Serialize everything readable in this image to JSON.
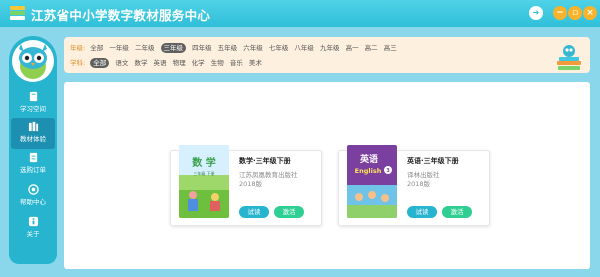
{
  "window": {
    "title": "江苏省中小学数字教材服务中心"
  },
  "colors": {
    "accent": "#26b4cf",
    "header": "#3fc8e0",
    "filter_bg": "#fdf0df",
    "activate": "#2fcf93",
    "title_buttons": "#f6b32b"
  },
  "sidebar": {
    "items": [
      {
        "label": "学习空间",
        "icon": "book-icon",
        "active": false
      },
      {
        "label": "教材体验",
        "icon": "books-icon",
        "active": true
      },
      {
        "label": "选购订单",
        "icon": "order-icon",
        "active": false
      },
      {
        "label": "帮助中心",
        "icon": "help-icon",
        "active": false
      },
      {
        "label": "关于",
        "icon": "info-icon",
        "active": false
      }
    ]
  },
  "filters": {
    "grade_label": "年级:",
    "grades": [
      "全部",
      "一年级",
      "二年级",
      "三年级",
      "四年级",
      "五年级",
      "六年级",
      "七年级",
      "八年级",
      "九年级",
      "高一",
      "高二",
      "高三"
    ],
    "grade_selected": "三年级",
    "subject_label": "学科:",
    "subjects": [
      "全部",
      "语文",
      "数学",
      "英语",
      "物理",
      "化学",
      "生物",
      "音乐",
      "美术"
    ],
    "subject_selected": "全部"
  },
  "books": [
    {
      "title": "数学·三年级下册",
      "publisher": "江苏凤凰教育出版社",
      "year": "2018版",
      "cover_text": "数  学",
      "cover_sub": "三年级 下册",
      "try_label": "试读",
      "activate_label": "激活"
    },
    {
      "title": "英语·三年级下册",
      "publisher": "译林出版社",
      "year": "2018版",
      "cover_text": "英语",
      "cover_sub": "English",
      "cover_badge": "3",
      "try_label": "试读",
      "activate_label": "激活"
    }
  ]
}
